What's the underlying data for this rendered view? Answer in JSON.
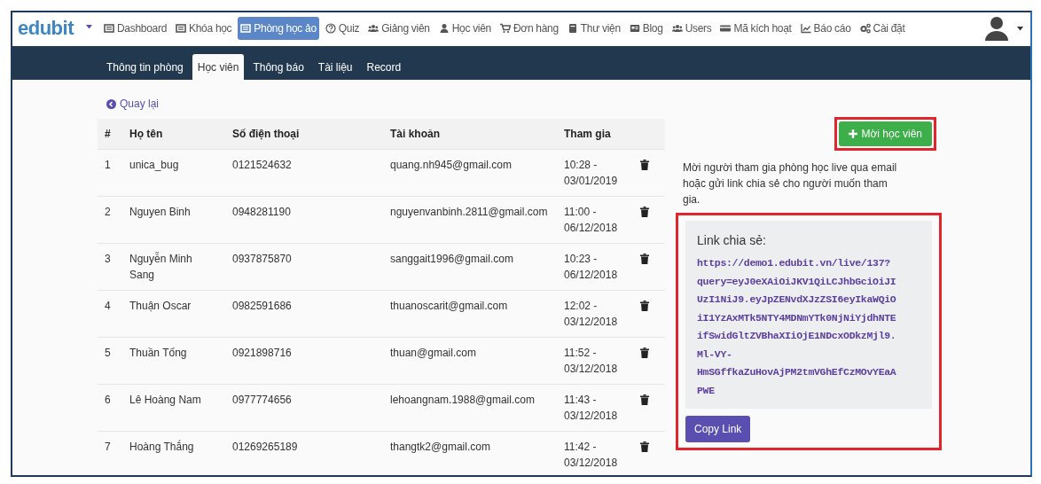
{
  "brand": {
    "logo": "edubit"
  },
  "nav": [
    {
      "label": "Dashboard",
      "selected": false
    },
    {
      "label": "Khóa học",
      "selected": false
    },
    {
      "label": "Phòng học ảo",
      "selected": true
    },
    {
      "label": "Quiz",
      "selected": false
    },
    {
      "label": "Giảng viên",
      "selected": false
    },
    {
      "label": "Học viên",
      "selected": false
    },
    {
      "label": "Đơn hàng",
      "selected": false
    },
    {
      "label": "Thư viện",
      "selected": false
    },
    {
      "label": "Blog",
      "selected": false
    },
    {
      "label": "Users",
      "selected": false
    },
    {
      "label": "Mã kích hoạt",
      "selected": false
    },
    {
      "label": "Báo cáo",
      "selected": false
    },
    {
      "label": "Cài đặt",
      "selected": false
    }
  ],
  "tabs": [
    {
      "label": "Thông tin phòng",
      "selected": false
    },
    {
      "label": "Học viên",
      "selected": true
    },
    {
      "label": "Thông báo",
      "selected": false
    },
    {
      "label": "Tài liệu",
      "selected": false
    },
    {
      "label": "Record",
      "selected": false
    }
  ],
  "back_link": "Quay lại",
  "table": {
    "columns": [
      "#",
      "Họ tên",
      "Số điện thoại",
      "Tài khoản",
      "Tham gia"
    ],
    "rows": [
      {
        "index": "1",
        "name": "unica_bug",
        "phone": "0121524632",
        "account": "quang.nh945@gmail.com",
        "joined": [
          "10:28 -",
          "03/01/2019"
        ]
      },
      {
        "index": "2",
        "name": "Nguyen Binh",
        "phone": "0948281190",
        "account": "nguyenvanbinh.2811@gmail.com",
        "joined": [
          "11:00 -",
          "06/12/2018"
        ]
      },
      {
        "index": "3",
        "name": "Nguyễn Minh Sang",
        "phone": "0937875870",
        "account": "sanggait1996@gmail.com",
        "joined": [
          "10:23 -",
          "06/12/2018"
        ]
      },
      {
        "index": "4",
        "name": "Thuận Oscar",
        "phone": "0982591686",
        "account": "thuanoscarit@gmail.com",
        "joined": [
          "12:02 -",
          "03/12/2018"
        ]
      },
      {
        "index": "5",
        "name": "Thuần Tống",
        "phone": "0921898716",
        "account": "thuan@gmail.com",
        "joined": [
          "11:52 -",
          "03/12/2018"
        ]
      },
      {
        "index": "6",
        "name": "Lê Hoàng Nam",
        "phone": "0977774656",
        "account": "lehoangnam.1988@gmail.com",
        "joined": [
          "11:43 -",
          "03/12/2018"
        ]
      },
      {
        "index": "7",
        "name": "Hoàng Thắng",
        "phone": "01269265189",
        "account": "thangtk2@gmail.com",
        "joined": [
          "11:42 -",
          "03/12/2018"
        ]
      }
    ]
  },
  "invite": {
    "button": "Mời học viên",
    "highlighted": true,
    "description": "Mời người tham gia phòng học live qua email hoặc gửi link chia sẻ cho người muốn tham gia."
  },
  "share": {
    "title": "Link chia sẻ:",
    "highlighted": true,
    "link_lines": [
      "https://demo1.edubit.vn/live/137?",
      "query=eyJ0eXAiOiJKV1QiLCJhbGciOiJI",
      "UzI1NiJ9.eyJpZENvdXJzZSI6eyIkaWQiO",
      "iI1YzAxMTk5NTY4MDNmYTk0NjNiYjdhNTE",
      "ifSwidGltZVBhaXIiOjE1NDcxODkzMjl9.",
      "Ml-VY-",
      "HmSGffkaZuHovAjPM2tmVGhEfCzMOvYEaA",
      "PWE"
    ],
    "copy_button": "Copy Link"
  }
}
